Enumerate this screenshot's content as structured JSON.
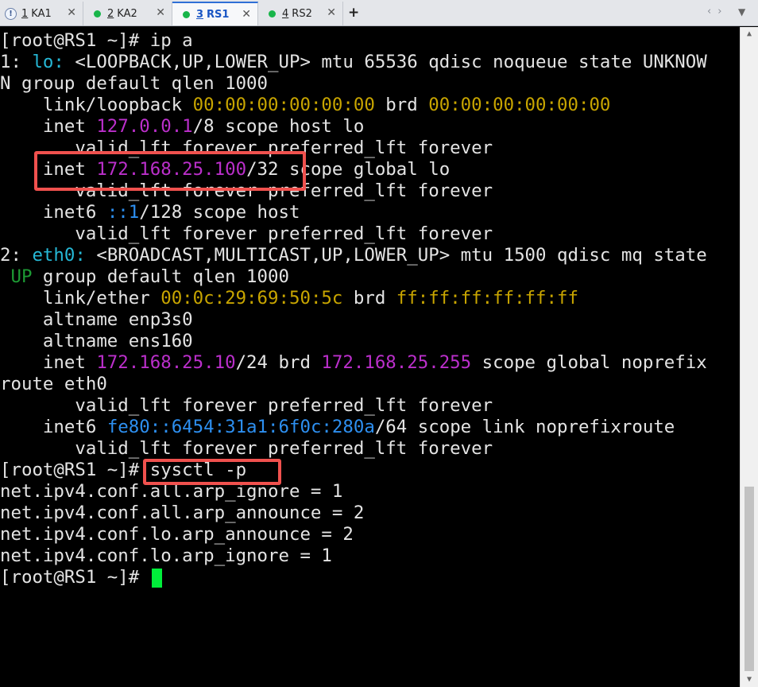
{
  "tabs": [
    {
      "num": "1",
      "label": "KA1",
      "status": "warning",
      "icon": "info-circle-icon",
      "close": "✕"
    },
    {
      "num": "2",
      "label": "KA2",
      "status": "connected",
      "icon": "green-dot-icon",
      "close": "✕"
    },
    {
      "num": "3",
      "label": "RS1",
      "status": "connected",
      "icon": "green-dot-icon",
      "close": "✕",
      "active": true
    },
    {
      "num": "4",
      "label": "RS2",
      "status": "connected",
      "icon": "green-dot-icon",
      "close": "✕"
    }
  ],
  "tabbar": {
    "add": "+",
    "prev": "‹",
    "next": "›",
    "menu": "▼"
  },
  "colors": {
    "accent": "#2f6fd6",
    "connected": "#19b54a",
    "cursor": "#00ee3a",
    "highlight": "#f0514e"
  },
  "terminal": {
    "lines": [
      [
        {
          "t": "[root@RS1 ~]# ip a"
        }
      ],
      [
        {
          "t": "1: "
        },
        {
          "t": "lo:",
          "c": "cyan"
        },
        {
          "t": " <LOOPBACK,UP,LOWER_UP> mtu 65536 qdisc noqueue state UNKNOW"
        }
      ],
      [
        {
          "t": "N group default qlen 1000"
        }
      ],
      [
        {
          "t": "    link/loopback "
        },
        {
          "t": "00:00:00:00:00:00",
          "c": "yel"
        },
        {
          "t": " brd "
        },
        {
          "t": "00:00:00:00:00:00",
          "c": "yel"
        }
      ],
      [
        {
          "t": "    inet "
        },
        {
          "t": "127.0.0.1",
          "c": "mag"
        },
        {
          "t": "/8 scope host lo"
        }
      ],
      [
        {
          "t": "       valid_lft forever preferred_lft forever"
        }
      ],
      [
        {
          "t": "    inet "
        },
        {
          "t": "172.168.25.100",
          "c": "mag"
        },
        {
          "t": "/32 scope global lo"
        }
      ],
      [
        {
          "t": "       valid_lft forever preferred_lft forever"
        }
      ],
      [
        {
          "t": "    inet6 "
        },
        {
          "t": "::1",
          "c": "blue"
        },
        {
          "t": "/128 scope host"
        }
      ],
      [
        {
          "t": "       valid_lft forever preferred_lft forever"
        }
      ],
      [
        {
          "t": "2: "
        },
        {
          "t": "eth0:",
          "c": "cyan"
        },
        {
          "t": " <BROADCAST,MULTICAST,UP,LOWER_UP> mtu 1500 qdisc mq state"
        }
      ],
      [
        {
          "t": " "
        },
        {
          "t": "UP",
          "c": "green"
        },
        {
          "t": " group default qlen 1000"
        }
      ],
      [
        {
          "t": "    link/ether "
        },
        {
          "t": "00:0c:29:69:50:5c",
          "c": "yel"
        },
        {
          "t": " brd "
        },
        {
          "t": "ff:ff:ff:ff:ff:ff",
          "c": "yel"
        }
      ],
      [
        {
          "t": "    altname enp3s0"
        }
      ],
      [
        {
          "t": "    altname ens160"
        }
      ],
      [
        {
          "t": "    inet "
        },
        {
          "t": "172.168.25.10",
          "c": "mag"
        },
        {
          "t": "/24 brd "
        },
        {
          "t": "172.168.25.255",
          "c": "mag"
        },
        {
          "t": " scope global noprefix"
        }
      ],
      [
        {
          "t": "route eth0"
        }
      ],
      [
        {
          "t": "       valid_lft forever preferred_lft forever"
        }
      ],
      [
        {
          "t": "    inet6 "
        },
        {
          "t": "fe80::6454:31a1:6f0c:280a",
          "c": "blue"
        },
        {
          "t": "/64 scope link noprefixroute"
        }
      ],
      [
        {
          "t": "       valid_lft forever preferred_lft forever"
        }
      ],
      [
        {
          "t": "[root@RS1 ~]# sysctl -p"
        }
      ],
      [
        {
          "t": "net.ipv4.conf.all.arp_ignore = 1"
        }
      ],
      [
        {
          "t": "net.ipv4.conf.all.arp_announce = 2"
        }
      ],
      [
        {
          "t": "net.ipv4.conf.lo.arp_announce = 2"
        }
      ],
      [
        {
          "t": "net.ipv4.conf.lo.arp_ignore = 1"
        }
      ],
      [
        {
          "t": "[root@RS1 ~]# "
        }
      ]
    ]
  }
}
